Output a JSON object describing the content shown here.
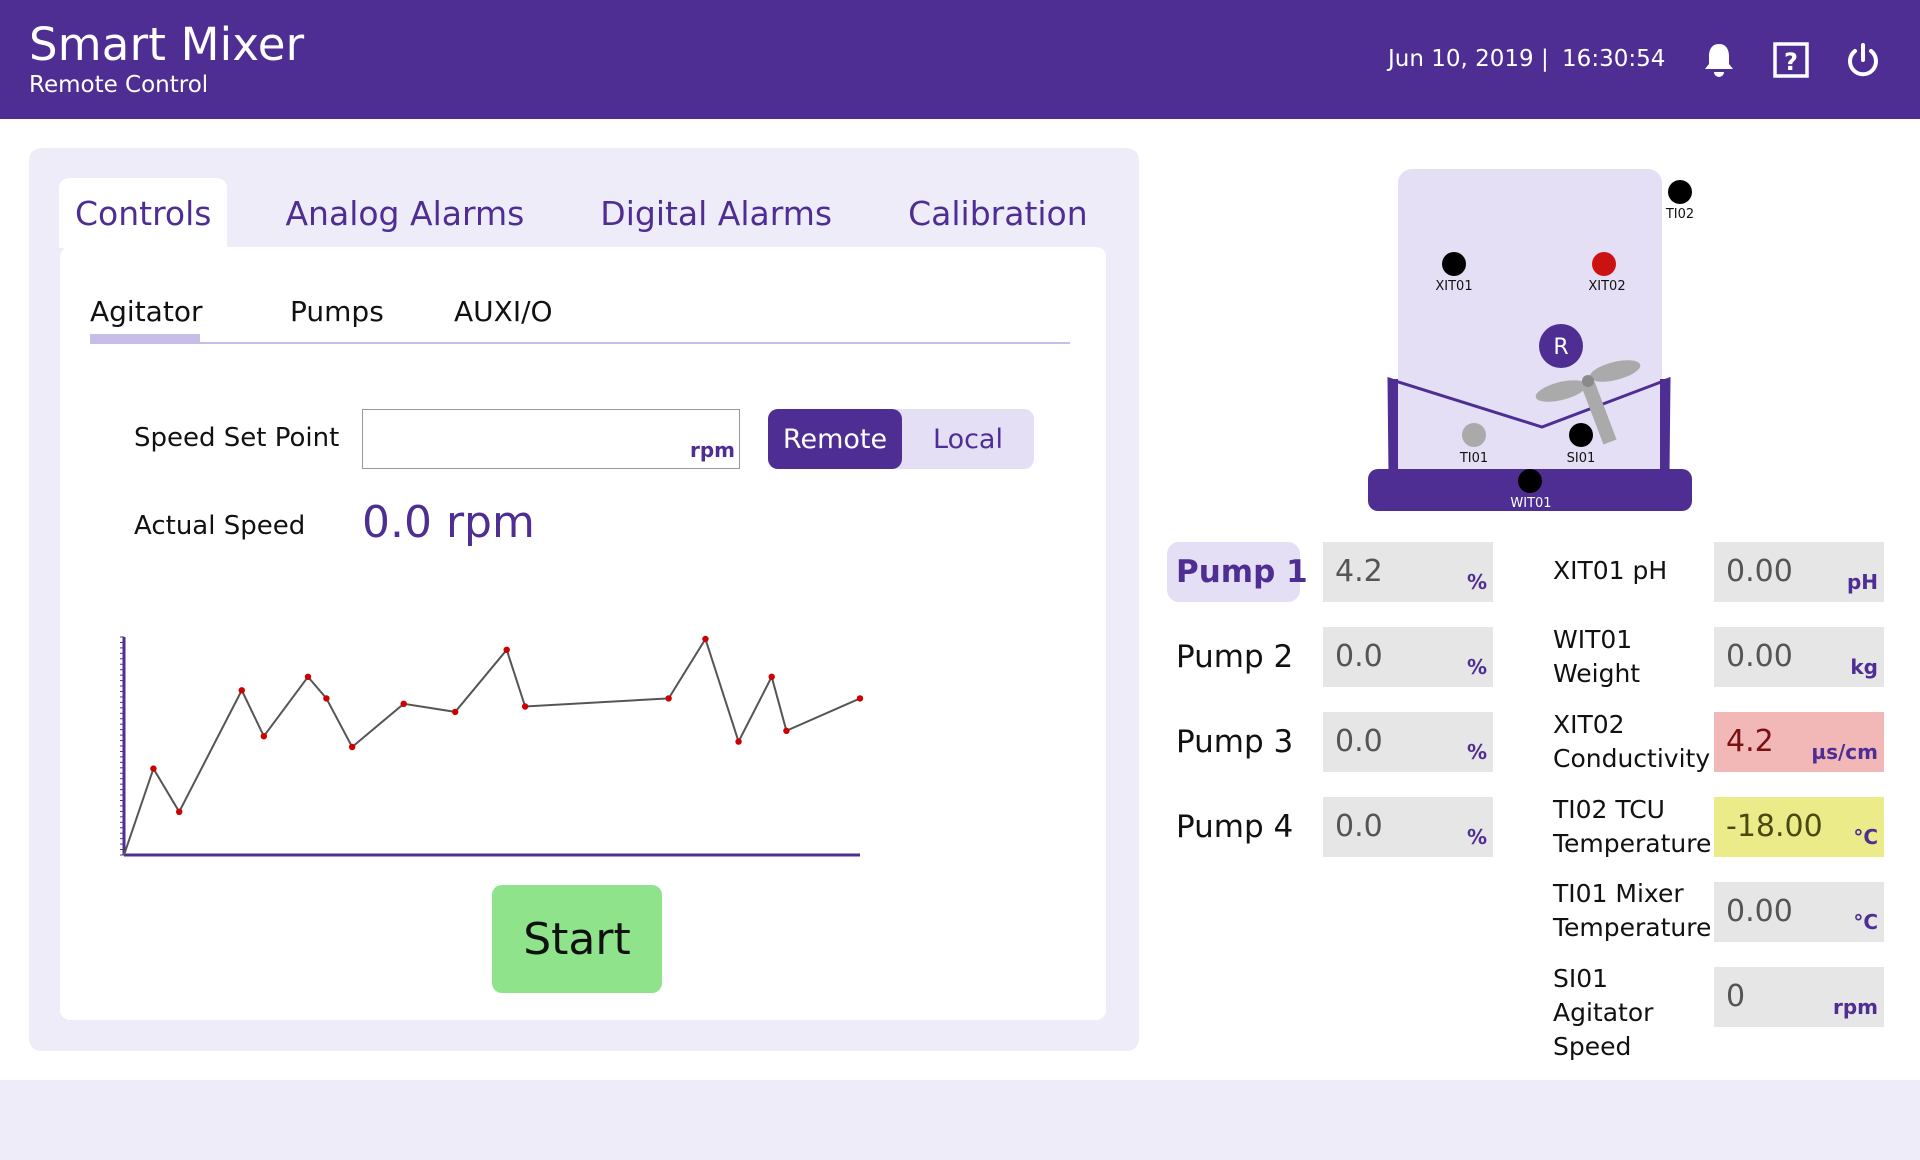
{
  "header": {
    "title": "Smart Mixer",
    "subtitle": "Remote Control",
    "date": "Jun 10, 2019 |",
    "time": "16:30:54",
    "icons": [
      "bell-icon",
      "help-icon",
      "power-icon"
    ]
  },
  "tabs": [
    {
      "label": "Controls",
      "active": true
    },
    {
      "label": "Analog Alarms"
    },
    {
      "label": "Digital Alarms"
    },
    {
      "label": "Calibration"
    }
  ],
  "subtabs": [
    {
      "label": "Agitator",
      "active": true
    },
    {
      "label": "Pumps"
    },
    {
      "label": "AUXI/O"
    }
  ],
  "controls": {
    "speed_set_point_label": "Speed Set Point",
    "speed_set_point_value": "",
    "speed_unit": "rpm",
    "mode_remote": "Remote",
    "mode_local": "Local",
    "mode_selected": "Remote",
    "actual_speed_label": "Actual Speed",
    "actual_speed_value": "0.0 rpm",
    "start_label": "Start"
  },
  "chart_data": {
    "type": "line",
    "title": "",
    "xlabel": "",
    "ylabel": "",
    "grid": false,
    "x": [
      0,
      4,
      7.5,
      16,
      19,
      25,
      27.5,
      31,
      38,
      45,
      52,
      54.5,
      74,
      79,
      83.5,
      88,
      90,
      100
    ],
    "values": [
      0,
      32,
      16,
      61,
      44,
      66,
      58,
      40,
      56,
      53,
      76,
      55,
      58,
      80,
      42,
      66,
      46,
      58
    ],
    "ylim": [
      0,
      100
    ],
    "xlim": [
      0,
      100
    ],
    "line_color": "#555555",
    "point_color": "#cc0000"
  },
  "diagram": {
    "sensors": [
      {
        "id": "TI02",
        "color": "#000000"
      },
      {
        "id": "XIT01",
        "color": "#000000"
      },
      {
        "id": "XIT02",
        "color": "#cc1111"
      },
      {
        "id": "TI01",
        "color": "#aaaaaa"
      },
      {
        "id": "SI01",
        "color": "#000000"
      },
      {
        "id": "WIT01",
        "color": "#000000"
      }
    ],
    "agitator_badge": "R"
  },
  "pumps": [
    {
      "label": "Pump 1",
      "value": "4.2",
      "unit": "%",
      "active": true
    },
    {
      "label": "Pump 2",
      "value": "0.0",
      "unit": "%"
    },
    {
      "label": "Pump 3",
      "value": "0.0",
      "unit": "%"
    },
    {
      "label": "Pump 4",
      "value": "0.0",
      "unit": "%"
    }
  ],
  "sensors": [
    {
      "label": "XIT01 pH",
      "value": "0.00",
      "unit": "pH",
      "state": "normal"
    },
    {
      "label": "WIT01 Weight",
      "value": "0.00",
      "unit": "kg",
      "state": "normal"
    },
    {
      "label": "XIT02 Conductivity",
      "value": "4.2",
      "unit": "µs/cm",
      "state": "alarm",
      "color": "#f2b8b8"
    },
    {
      "label": "TI02 TCU Temperature",
      "value": "-18.00",
      "unit": "°C",
      "state": "warning",
      "color": "#ebeb8a"
    },
    {
      "label": "TI01 Mixer Temperature",
      "value": "0.00",
      "unit": "°C",
      "state": "normal"
    },
    {
      "label": "SI01 Agitator Speed",
      "value": "0",
      "unit": "rpm",
      "state": "normal"
    }
  ],
  "colors": {
    "brand": "#4f2e93",
    "panel": "#efecf9",
    "start": "#8fe38a",
    "alarm": "#f2b8b8",
    "warning": "#ebeb8a"
  }
}
